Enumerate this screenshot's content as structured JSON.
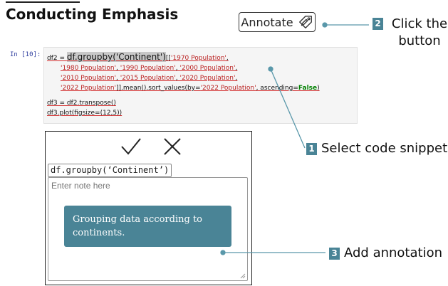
{
  "header": {
    "title": "Conducting Emphasis"
  },
  "annotate_button": {
    "label": "Annotate",
    "icon": "tag-pencil-icon"
  },
  "steps": [
    {
      "number": "2",
      "text": "Click the button"
    },
    {
      "number": "1",
      "text": "Select code snippet"
    },
    {
      "number": "3",
      "text": "Add annotation"
    }
  ],
  "notebook": {
    "prompt": "In [10]:",
    "code": {
      "l1_a": "df2 = ",
      "l1_sel": "df.groupby('Continent')",
      "l1_b": "[[",
      "l1_s1": "'1970 Population'",
      "l1_c": ",",
      "l2_s1": "'1980 Population'",
      "l2_s2": "'1990 Population'",
      "l2_s3": "'2000 Population'",
      "l3_s1": "'2010 Population'",
      "l3_s2": "'2015 Population'",
      "l3_s3": "'2020 Population'",
      "l4_s1": "'2022 Population'",
      "l4_b": "]].mean().sort_values(by=",
      "l4_s2": "'2022 Population'",
      "l4_c": ", ascending=",
      "l4_kw": "False",
      "l4_d": ")",
      "l5": "df3 = df2.transpose()",
      "l6": "df3.plot(figsize=(12,5))",
      "sep": ", "
    }
  },
  "note_panel": {
    "confirm_icon": "check-icon",
    "cancel_icon": "close-icon",
    "snippet": "df.groupby(‘Continent’)",
    "placeholder": "Enter note here",
    "annotation": "Grouping data according to continents."
  },
  "colors": {
    "accent": "#4a8496",
    "connector": "#5a98aa"
  }
}
